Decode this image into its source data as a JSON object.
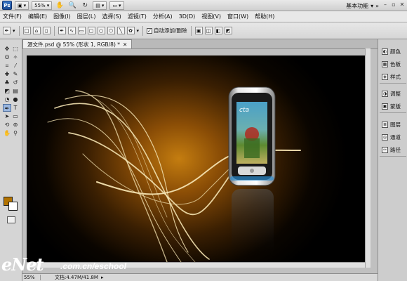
{
  "appbar": {
    "logo": "Ps",
    "zoom": "55%",
    "workspace": "基本功能"
  },
  "menu": [
    "文件(F)",
    "编辑(E)",
    "图像(I)",
    "图层(L)",
    "选择(S)",
    "滤镜(T)",
    "分析(A)",
    "3D(D)",
    "视图(V)",
    "窗口(W)",
    "帮助(H)"
  ],
  "options": {
    "auto_add_delete_label": "自动添加/删除"
  },
  "document": {
    "tab_title": "源文件.psd @ 55% (形状 1, RGB/8) *"
  },
  "status": {
    "zoom": "55%",
    "doc_size": "文档:4.47M/41.8M"
  },
  "panels": {
    "group1": [
      "颜色",
      "色板",
      "样式"
    ],
    "group2": [
      "调整",
      "蒙版"
    ],
    "group3": [
      "图层",
      "通道",
      "路径"
    ]
  },
  "watermark": {
    "brand": "eNet",
    "url": ".com.cn/eschool"
  },
  "colors": {
    "foreground": "#b37300",
    "background": "#ffffff",
    "canvas_glow": "#c47d10"
  }
}
